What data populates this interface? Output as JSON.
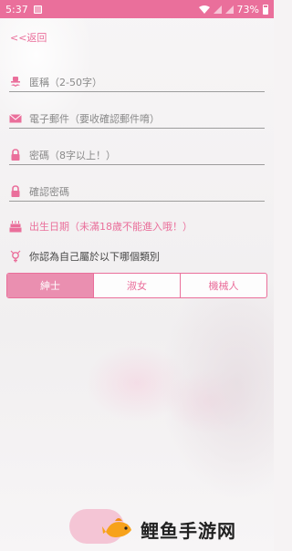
{
  "statusbar": {
    "time": "5:37",
    "battery": "73%"
  },
  "nav": {
    "back_label": "<<返回"
  },
  "form": {
    "nickname_placeholder": "匿稱（2-50字）",
    "email_placeholder": "電子郵件（要收確認郵件唷）",
    "password_placeholder": "密碼（8字以上！）",
    "confirm_password_placeholder": "確認密碼",
    "birthday_label": "出生日期（未滿18歲不能進入哦！）",
    "gender_question": "你認為自己屬於以下哪個類別",
    "gender_options": [
      "紳士",
      "淑女",
      "機械人"
    ],
    "gender_selected": "紳士"
  },
  "watermark": {
    "text": "鲤鱼手游网"
  },
  "colors": {
    "accent": "#ea6f9b",
    "active_segment": "#ea8fb0"
  }
}
